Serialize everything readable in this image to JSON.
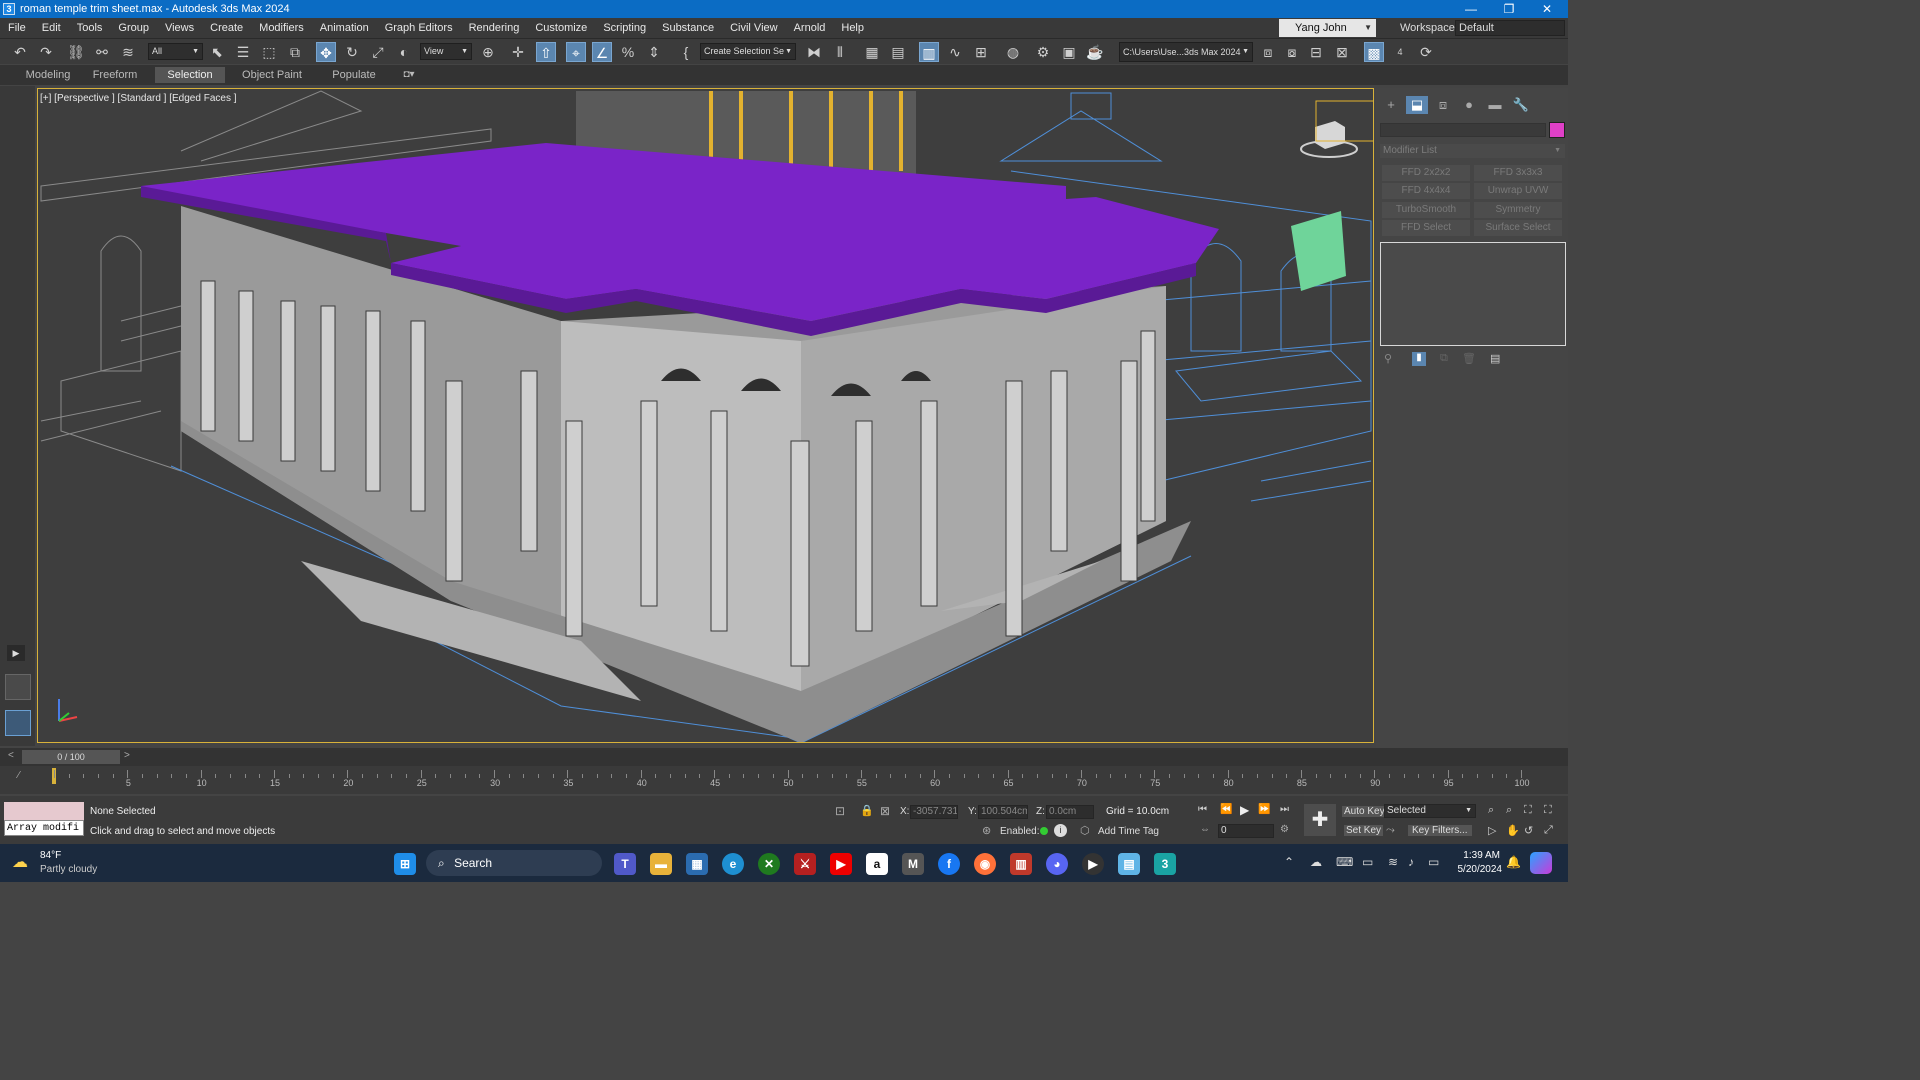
{
  "window": {
    "title": "roman temple trim sheet.max - Autodesk 3ds Max 2024",
    "min": "—",
    "max": "❐",
    "close": "✕",
    "app_icon": "3"
  },
  "menu": [
    "File",
    "Edit",
    "Tools",
    "Group",
    "Views",
    "Create",
    "Modifiers",
    "Animation",
    "Graph Editors",
    "Rendering",
    "Customize",
    "Scripting",
    "Substance",
    "Civil View",
    "Arnold",
    "Help"
  ],
  "user": {
    "name": "Yang John"
  },
  "workspace": {
    "label": "Workspaces:",
    "value": "Default"
  },
  "toolbar": {
    "filter": "All",
    "ref_coord": "View",
    "selection_set": "Create Selection Se",
    "project_path": "C:\\Users\\Use...3ds Max 2024",
    "counter": "4"
  },
  "ribbon_tabs": [
    "Modeling",
    "Freeform",
    "Selection",
    "Object Paint",
    "Populate"
  ],
  "viewport": {
    "label": "[+] [Perspective ] [Standard ] [Edged Faces ]"
  },
  "command_panel": {
    "modifier_list": "Modifier List",
    "object_color": "#e040c8",
    "modifiers": [
      "FFD 2x2x2",
      "FFD 3x3x3",
      "FFD 4x4x4",
      "Unwrap UVW",
      "TurboSmooth",
      "Symmetry",
      "FFD Select",
      "Surface Select"
    ]
  },
  "timeline": {
    "frame": "0 / 100",
    "ticks": [
      "5",
      "10",
      "15",
      "20",
      "25",
      "30",
      "35",
      "40",
      "45",
      "50",
      "55",
      "60",
      "65",
      "70",
      "75",
      "80",
      "85",
      "90",
      "95",
      "100"
    ]
  },
  "status": {
    "maxscript": "Array modifi",
    "selection": "None Selected",
    "prompt": "Click and drag to select and move objects",
    "x_label": "X:",
    "x_value": "-3057.731c",
    "y_label": "Y:",
    "y_value": "100.504cm",
    "z_label": "Z:",
    "z_value": "0.0cm",
    "grid": "Grid = 10.0cm",
    "enabled": "Enabled:",
    "add_time_tag": "Add Time Tag",
    "auto_key": "Auto Key",
    "set_key": "Set Key",
    "key_mode": "Selected",
    "key_filters": "Key Filters...",
    "frame_field": "0"
  },
  "taskbar": {
    "temperature": "84°F",
    "weather": "Partly cloudy",
    "search": "Search",
    "time": "1:39 AM",
    "date": "5/20/2024"
  }
}
